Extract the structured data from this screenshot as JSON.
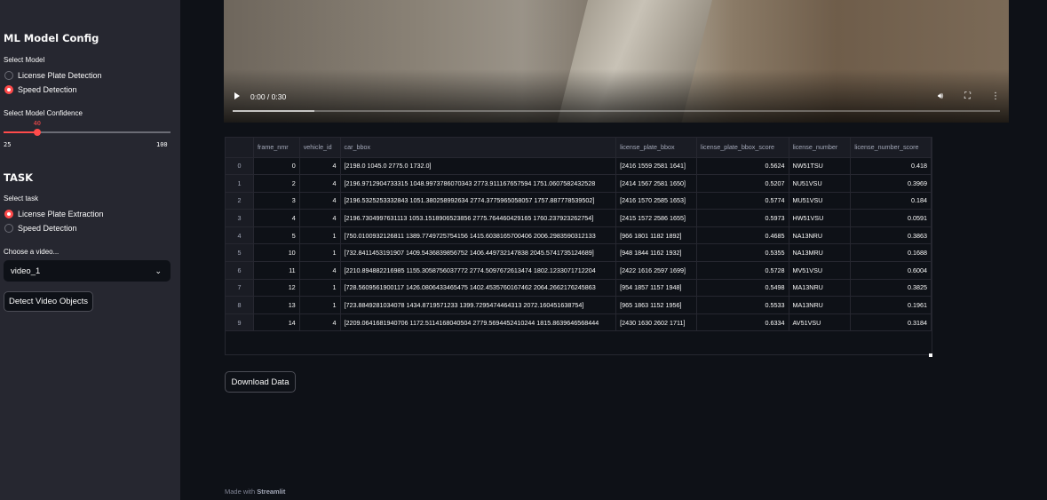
{
  "sidebar": {
    "config_heading": "ML Model Config",
    "select_model_label": "Select Model",
    "model_options": [
      {
        "label": "License Plate Detection",
        "selected": false
      },
      {
        "label": "Speed Detection",
        "selected": true
      }
    ],
    "confidence_label": "Select Model Confidence",
    "confidence": {
      "value": "40",
      "min": "25",
      "max": "100",
      "value_num": 40,
      "min_num": 25,
      "max_num": 100
    },
    "task_heading": "TASK",
    "select_task_label": "Select task",
    "task_options": [
      {
        "label": "License Plate Extraction",
        "selected": true
      },
      {
        "label": "Speed Detection",
        "selected": false
      }
    ],
    "video_select_label": "Choose a video...",
    "video_selected": "video_1",
    "detect_button": "Detect Video Objects"
  },
  "video": {
    "time": "0:00 / 0:30",
    "progress_fraction": 0.0,
    "buffered_fraction": 0.107,
    "icons": [
      "play-icon",
      "volume-icon",
      "fullscreen-icon",
      "more-options-icon"
    ]
  },
  "table": {
    "columns": [
      "",
      "frame_nmr",
      "vehicle_id",
      "car_bbox",
      "license_plate_bbox",
      "license_plate_bbox_score",
      "license_number",
      "license_number_score"
    ],
    "rows": [
      [
        "0",
        "0",
        "4",
        "[2198.0 1045.0 2775.0 1732.0]",
        "[2416 1559 2581 1641]",
        "0.5624",
        "NW51TSU",
        "0.418"
      ],
      [
        "1",
        "2",
        "4",
        "[2196.9712904733315 1048.9973786070343 2773.911167657594 1751.0607582432528",
        "[2414 1567 2581 1650]",
        "0.5207",
        "NU51VSU",
        "0.3969"
      ],
      [
        "2",
        "3",
        "4",
        "[2196.5325253332843 1051.380258992634 2774.3775965058057 1757.887778539502]",
        "[2416 1570 2585 1653]",
        "0.5774",
        "MU51VSU",
        "0.184"
      ],
      [
        "3",
        "4",
        "4",
        "[2196.7304997631113 1053.1518906523856 2775.764460429165 1760.237923262754]",
        "[2415 1572 2586 1655]",
        "0.5973",
        "HW51VSU",
        "0.0591"
      ],
      [
        "4",
        "5",
        "1",
        "[750.0100932126811 1389.7749725754156 1415.6038165700406 2006.2983590312133",
        "[966 1801 1182 1892]",
        "0.4685",
        "NA13NRU",
        "0.3863"
      ],
      [
        "5",
        "10",
        "1",
        "[732.8411453191907 1409.5436839856752 1406.449732147838 2045.5741735124689]",
        "[948 1844 1162 1932]",
        "0.5355",
        "NA13MRU",
        "0.1688"
      ],
      [
        "6",
        "11",
        "4",
        "[2210.894882216985 1155.3058756037772 2774.5097672613474 1802.1233071712204",
        "[2422 1616 2597 1699]",
        "0.5728",
        "MV51VSU",
        "0.6004"
      ],
      [
        "7",
        "12",
        "1",
        "[728.5609561900117 1426.0806433465475 1402.4535760167462 2064.2662176245863",
        "[954 1857 1157 1948]",
        "0.5498",
        "MA13NRU",
        "0.3825"
      ],
      [
        "8",
        "13",
        "1",
        "[723.8849281034078 1434.8719571233 1399.7295474464313 2072.160451638754]",
        "[965 1863 1152 1956]",
        "0.5533",
        "MA13NRU",
        "0.1961"
      ],
      [
        "9",
        "14",
        "4",
        "[2209.0641681940706 1172.5114168040504 2779.5694452410244 1815.8639646568444",
        "[2430 1630 2602 1711]",
        "0.6334",
        "AV51VSU",
        "0.3184"
      ]
    ]
  },
  "download_button": "Download Data",
  "footer": {
    "prefix": "Made with ",
    "brand": "Streamlit"
  },
  "colors": {
    "accent": "#ff4b4b",
    "background": "#0e1117",
    "sidebar": "#262730"
  }
}
